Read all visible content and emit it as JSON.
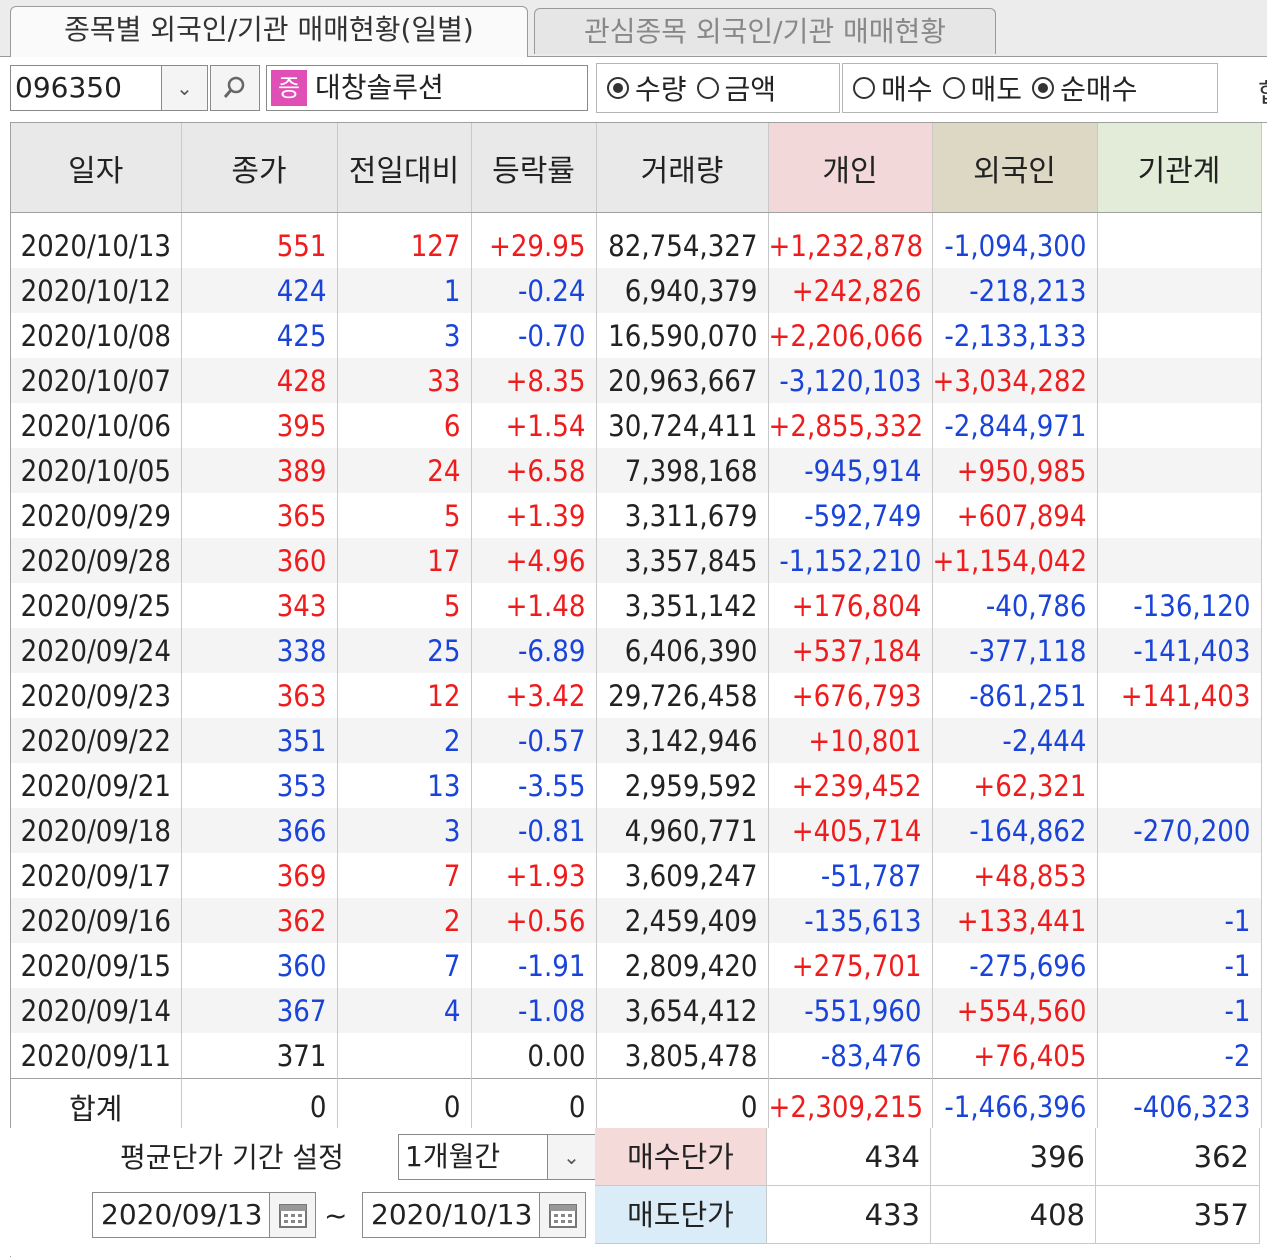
{
  "tabs": [
    {
      "label": "종목별 외국인/기관 매매현황(일별)",
      "active": true
    },
    {
      "label": "관심종목 외국인/기관 매매현황",
      "active": false
    }
  ],
  "toolbar": {
    "code": "096350",
    "market_badge": "증",
    "stock_name": "대창솔루션",
    "unit_options": [
      {
        "label": "수량",
        "selected": true
      },
      {
        "label": "금액",
        "selected": false
      }
    ],
    "trade_options": [
      {
        "label": "매수",
        "selected": false
      },
      {
        "label": "매도",
        "selected": false
      },
      {
        "label": "순매수",
        "selected": true
      }
    ],
    "trailing_label": "합"
  },
  "table": {
    "headers": [
      "일자",
      "종가",
      "전일대비",
      "등락률",
      "거래량",
      "개인",
      "외국인",
      "기관계"
    ],
    "rows": [
      {
        "date": "2020/10/13",
        "close": "551",
        "change": "127",
        "rate": "+29.95",
        "volume": "82,754,327",
        "indiv": "+1,232,878",
        "foreign": "-1,094,300",
        "inst": "",
        "dir": "up"
      },
      {
        "date": "2020/10/12",
        "close": "424",
        "change": "1",
        "rate": "-0.24",
        "volume": "6,940,379",
        "indiv": "+242,826",
        "foreign": "-218,213",
        "inst": "",
        "dir": "down"
      },
      {
        "date": "2020/10/08",
        "close": "425",
        "change": "3",
        "rate": "-0.70",
        "volume": "16,590,070",
        "indiv": "+2,206,066",
        "foreign": "-2,133,133",
        "inst": "",
        "dir": "down"
      },
      {
        "date": "2020/10/07",
        "close": "428",
        "change": "33",
        "rate": "+8.35",
        "volume": "20,963,667",
        "indiv": "-3,120,103",
        "foreign": "+3,034,282",
        "inst": "",
        "dir": "up"
      },
      {
        "date": "2020/10/06",
        "close": "395",
        "change": "6",
        "rate": "+1.54",
        "volume": "30,724,411",
        "indiv": "+2,855,332",
        "foreign": "-2,844,971",
        "inst": "",
        "dir": "up"
      },
      {
        "date": "2020/10/05",
        "close": "389",
        "change": "24",
        "rate": "+6.58",
        "volume": "7,398,168",
        "indiv": "-945,914",
        "foreign": "+950,985",
        "inst": "",
        "dir": "up"
      },
      {
        "date": "2020/09/29",
        "close": "365",
        "change": "5",
        "rate": "+1.39",
        "volume": "3,311,679",
        "indiv": "-592,749",
        "foreign": "+607,894",
        "inst": "",
        "dir": "up"
      },
      {
        "date": "2020/09/28",
        "close": "360",
        "change": "17",
        "rate": "+4.96",
        "volume": "3,357,845",
        "indiv": "-1,152,210",
        "foreign": "+1,154,042",
        "inst": "",
        "dir": "up"
      },
      {
        "date": "2020/09/25",
        "close": "343",
        "change": "5",
        "rate": "+1.48",
        "volume": "3,351,142",
        "indiv": "+176,804",
        "foreign": "-40,786",
        "inst": "-136,120",
        "dir": "up"
      },
      {
        "date": "2020/09/24",
        "close": "338",
        "change": "25",
        "rate": "-6.89",
        "volume": "6,406,390",
        "indiv": "+537,184",
        "foreign": "-377,118",
        "inst": "-141,403",
        "dir": "down"
      },
      {
        "date": "2020/09/23",
        "close": "363",
        "change": "12",
        "rate": "+3.42",
        "volume": "29,726,458",
        "indiv": "+676,793",
        "foreign": "-861,251",
        "inst": "+141,403",
        "dir": "up"
      },
      {
        "date": "2020/09/22",
        "close": "351",
        "change": "2",
        "rate": "-0.57",
        "volume": "3,142,946",
        "indiv": "+10,801",
        "foreign": "-2,444",
        "inst": "",
        "dir": "down"
      },
      {
        "date": "2020/09/21",
        "close": "353",
        "change": "13",
        "rate": "-3.55",
        "volume": "2,959,592",
        "indiv": "+239,452",
        "foreign": "+62,321",
        "inst": "",
        "dir": "down"
      },
      {
        "date": "2020/09/18",
        "close": "366",
        "change": "3",
        "rate": "-0.81",
        "volume": "4,960,771",
        "indiv": "+405,714",
        "foreign": "-164,862",
        "inst": "-270,200",
        "dir": "down"
      },
      {
        "date": "2020/09/17",
        "close": "369",
        "change": "7",
        "rate": "+1.93",
        "volume": "3,609,247",
        "indiv": "-51,787",
        "foreign": "+48,853",
        "inst": "",
        "dir": "up"
      },
      {
        "date": "2020/09/16",
        "close": "362",
        "change": "2",
        "rate": "+0.56",
        "volume": "2,459,409",
        "indiv": "-135,613",
        "foreign": "+133,441",
        "inst": "-1",
        "dir": "up"
      },
      {
        "date": "2020/09/15",
        "close": "360",
        "change": "7",
        "rate": "-1.91",
        "volume": "2,809,420",
        "indiv": "+275,701",
        "foreign": "-275,696",
        "inst": "-1",
        "dir": "down"
      },
      {
        "date": "2020/09/14",
        "close": "367",
        "change": "4",
        "rate": "-1.08",
        "volume": "3,654,412",
        "indiv": "-551,960",
        "foreign": "+554,560",
        "inst": "-1",
        "dir": "down"
      },
      {
        "date": "2020/09/11",
        "close": "371",
        "change": "",
        "rate": "0.00",
        "volume": "3,805,478",
        "indiv": "-83,476",
        "foreign": "+76,405",
        "inst": "-2",
        "dir": "flat"
      }
    ],
    "total": {
      "label": "합계",
      "close": "0",
      "change": "0",
      "rate": "0",
      "volume": "0",
      "indiv": "+2,309,215",
      "foreign": "-1,466,396",
      "inst": "-406,323"
    }
  },
  "bottom": {
    "period_label": "평균단가 기간 설정",
    "period_value": "1개월간",
    "date_from": "2020/09/13",
    "tilde": "~",
    "date_to": "2020/10/13",
    "buy_label": "매수단가",
    "sell_label": "매도단가",
    "buy_prices": [
      "434",
      "396",
      "362"
    ],
    "sell_prices": [
      "433",
      "408",
      "357"
    ]
  },
  "colors": {
    "up": "#ee1c1c",
    "down": "#1a44d8",
    "individual_header": "#f2d8d8",
    "foreign_header": "#ddd8c4",
    "institution_header": "#e3ecd8"
  }
}
